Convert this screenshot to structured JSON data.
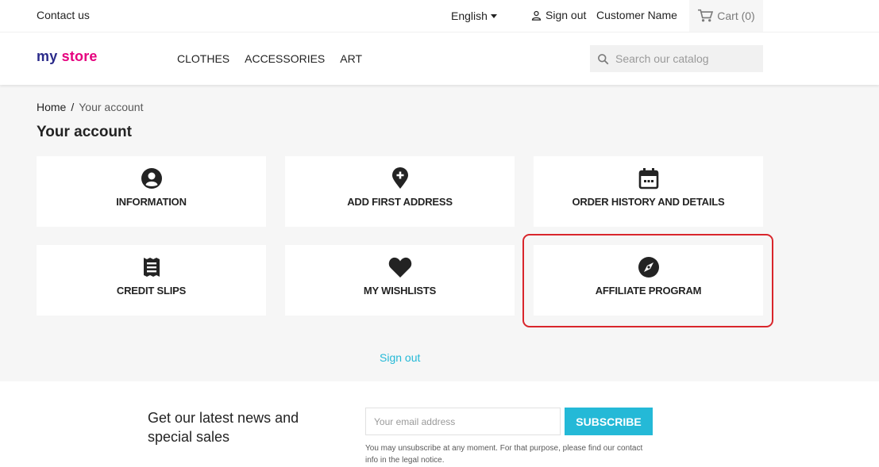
{
  "topbar": {
    "contact": "Contact us",
    "language": "English",
    "sign_out": "Sign out",
    "customer_name": "Customer Name",
    "cart": "Cart (0)"
  },
  "header": {
    "logo_part1": "my",
    "logo_part2": "store",
    "nav": [
      "CLOTHES",
      "ACCESSORIES",
      "ART"
    ],
    "search_placeholder": "Search our catalog"
  },
  "breadcrumb": {
    "home": "Home",
    "separator": "/",
    "current": "Your account"
  },
  "page_title": "Your account",
  "cards": [
    {
      "label": "INFORMATION",
      "icon": "user-circle-icon"
    },
    {
      "label": "ADD FIRST ADDRESS",
      "icon": "add-location-icon"
    },
    {
      "label": "ORDER HISTORY AND DETAILS",
      "icon": "calendar-icon"
    },
    {
      "label": "CREDIT SLIPS",
      "icon": "receipt-icon"
    },
    {
      "label": "MY WISHLISTS",
      "icon": "heart-icon"
    },
    {
      "label": "AFFILIATE PROGRAM",
      "icon": "compass-icon"
    }
  ],
  "sign_out_link": "Sign out",
  "newsletter": {
    "title": "Get our latest news and special sales",
    "email_placeholder": "Your email address",
    "subscribe": "SUBSCRIBE",
    "disclaimer": "You may unsubscribe at any moment. For that purpose, please find our contact info in the legal notice."
  },
  "colors": {
    "accent": "#24b9d7",
    "highlight": "#d9262c",
    "panel": "#f6f6f6"
  }
}
